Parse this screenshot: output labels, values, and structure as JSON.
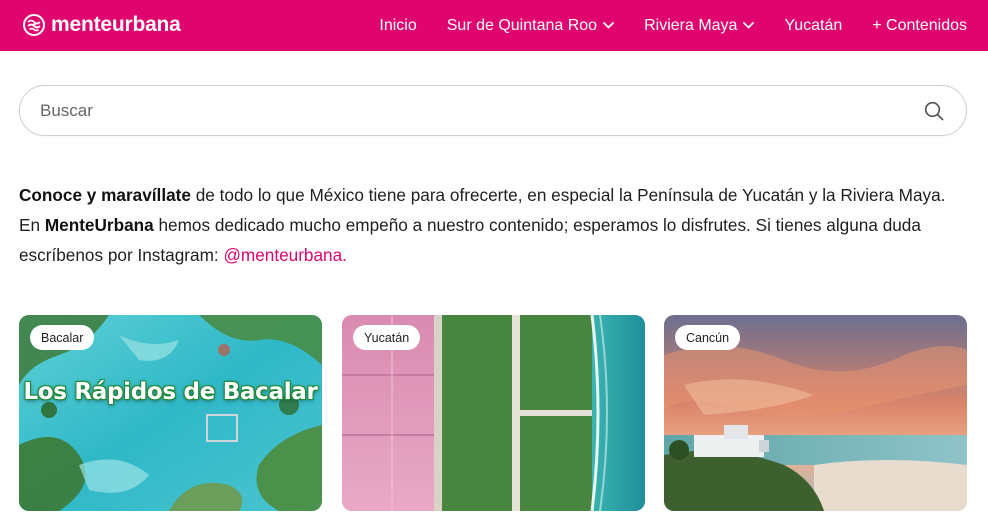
{
  "brand": {
    "name": "menteurbana",
    "primary_color": "#e0056e"
  },
  "nav": {
    "items": [
      {
        "label": "Inicio",
        "dropdown": false
      },
      {
        "label": "Sur de Quintana Roo",
        "dropdown": true
      },
      {
        "label": "Riviera Maya",
        "dropdown": true
      },
      {
        "label": "Yucatán",
        "dropdown": false
      },
      {
        "label": "+ Contenidos",
        "dropdown": false
      }
    ]
  },
  "search": {
    "placeholder": "Buscar",
    "value": ""
  },
  "intro": {
    "bold_1": "Conoce y maravíllate",
    "text_1": " de todo lo que México tiene para ofrecerte, en especial la Península de Yucatán y la Riviera Maya. En ",
    "bold_2": "MenteUrbana",
    "text_2": " hemos dedicado mucho empeño a nuestro contenido; esperamos lo disfrutes. Si tienes alguna duda escríbenos por Instagram: ",
    "link": "@menteurbana."
  },
  "cards": [
    {
      "tag": "Bacalar",
      "image_title": "Los Rápidos de Bacalar",
      "image": "aerial-turquoise-lagoon"
    },
    {
      "tag": "Yucatán",
      "image_title": "",
      "image": "aerial-pink-salt-lakes"
    },
    {
      "tag": "Cancún",
      "image_title": "",
      "image": "sunset-beach-hotel"
    }
  ]
}
